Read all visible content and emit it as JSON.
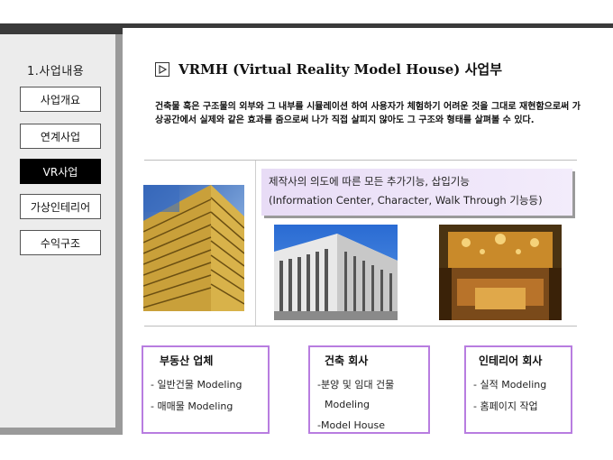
{
  "sidebar": {
    "heading": "1.사업내용",
    "items": [
      {
        "label": "사업개요"
      },
      {
        "label": "연계사업"
      },
      {
        "label": "VR사업"
      },
      {
        "label": "가상인테리어"
      },
      {
        "label": "수익구조"
      }
    ],
    "active_index": 2
  },
  "main": {
    "title": "VRMH (Virtual Reality Model House) 사업부",
    "intro": "건축물 혹은 구조물의 외부와 그 내부를 시뮬레이션 하여 사용자가 체험하기 어려운 것을 그대로 재현함으로써 가상공간에서 실제와 같은 효과를 줌으로써 나가 직접 살피지 않아도 그 구조와 형태를 살펴볼 수 있다.",
    "feature": {
      "line1": "제작사의 의도에 따른 모든 추가기능, 삽입기능",
      "line2": "(Information Center, Character, Walk Through 기능등)"
    },
    "cards": [
      {
        "title": "부동산 업체",
        "items": [
          "- 일반건물 Modeling",
          "- 매매물 Modeling"
        ]
      },
      {
        "title": "건축 회사",
        "items": [
          "-분양 및 임대 건물",
          "Modeling",
          "-Model House"
        ]
      },
      {
        "title": "인테리어 회사",
        "items": [
          "- 실적 Modeling",
          "- 홈페이지 작업"
        ]
      }
    ]
  },
  "colors": {
    "card_border": "#b87de0",
    "feature_bg": "#e8dcf6",
    "sidebar_bg": "#ececec",
    "active_button_bg": "#000000"
  },
  "icons": {
    "title_marker": "play-icon"
  }
}
